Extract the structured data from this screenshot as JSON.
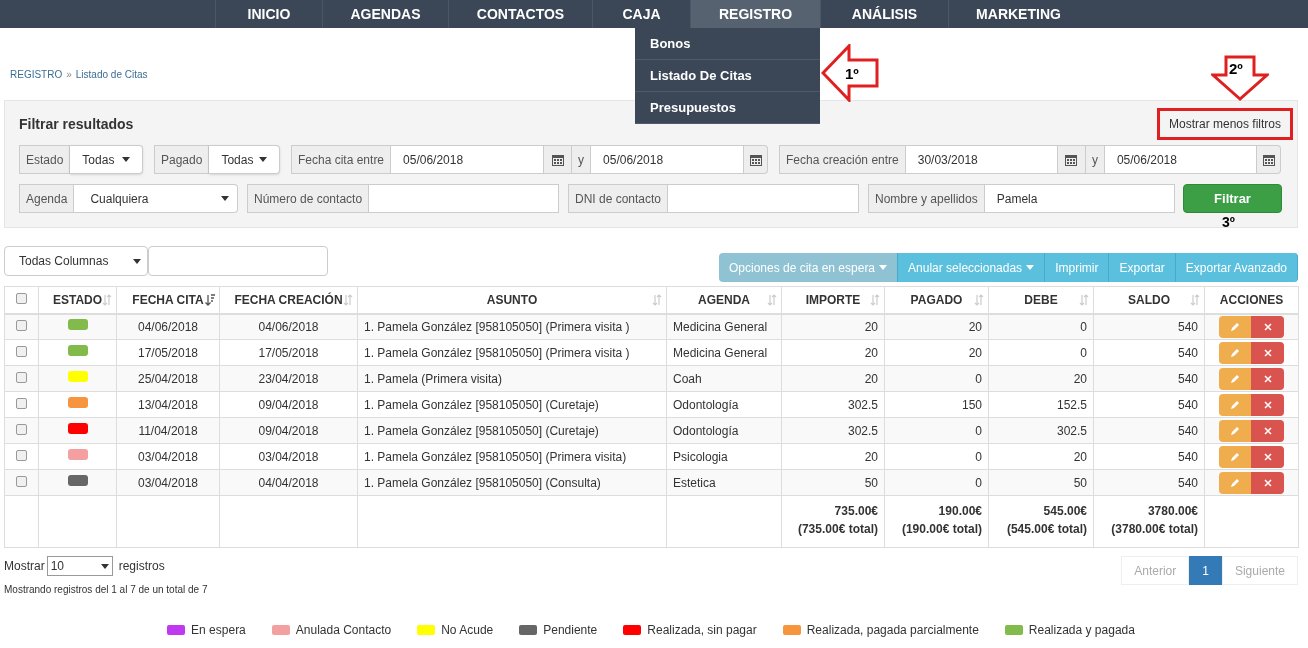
{
  "nav": {
    "items": [
      {
        "label": "INICIO",
        "selected": false
      },
      {
        "label": "AGENDAS",
        "selected": false
      },
      {
        "label": "CONTACTOS",
        "selected": false
      },
      {
        "label": "CAJA",
        "selected": false
      },
      {
        "label": "REGISTRO",
        "selected": true
      },
      {
        "label": "ANÁLISIS",
        "selected": false
      },
      {
        "label": "MARKETING",
        "selected": false
      }
    ],
    "dropdown": [
      "Bonos",
      "Listado De Citas",
      "Presupuestos"
    ]
  },
  "annotations": {
    "arrow_1": "1º",
    "arrow_2": "2º",
    "step_3": "3º"
  },
  "breadcrumb": {
    "items": [
      "REGISTRO",
      "Listado de Citas"
    ],
    "separator": "»"
  },
  "filters": {
    "title": "Filtrar resultados",
    "toggle": {
      "label": "Mostrar menos filtros",
      "highlighted": true
    },
    "row_1": [
      {
        "kind": "select",
        "label": "Estado",
        "value": "Todas"
      },
      {
        "kind": "select",
        "label": "Pagado",
        "value": "Todas"
      },
      {
        "kind": "daterange",
        "label": "Fecha cita entre",
        "from": "05/06/2018",
        "separator": "y",
        "to": "05/06/2018"
      },
      {
        "kind": "daterange",
        "label": "Fecha creación entre",
        "from": "30/03/2018",
        "separator": "y",
        "to": "05/06/2018"
      }
    ],
    "row_2": [
      {
        "kind": "wideselect",
        "label": "Agenda",
        "value": "Cualquiera"
      },
      {
        "kind": "text",
        "label": "Número de contacto"
      },
      {
        "kind": "text",
        "label": "DNI de contacto"
      },
      {
        "kind": "text",
        "label": "Nombre y apellidos",
        "value": "Pamela"
      }
    ],
    "submit": "Filtrar"
  },
  "toolbar": {
    "column_select": "Todas Columnas",
    "buttons": [
      {
        "label": "Opciones de cita en espera",
        "disabled": true,
        "caret": true
      },
      {
        "label": "Anular seleccionadas",
        "disabled": false,
        "caret": true
      },
      {
        "label": "Imprimir",
        "disabled": false,
        "caret": false
      },
      {
        "label": "Exportar",
        "disabled": false,
        "caret": false
      },
      {
        "label": "Exportar Avanzado",
        "disabled": false,
        "caret": false
      }
    ]
  },
  "table": {
    "columns": [
      {
        "kind": "checkbox",
        "checked": false
      },
      {
        "kind": "text",
        "label": "ESTADO",
        "sortable": true,
        "sorted": false
      },
      {
        "kind": "text",
        "label": "FECHA CITA",
        "sortable": true,
        "sorted": true
      },
      {
        "kind": "text",
        "label": "FECHA CREACIÓN",
        "sortable": true,
        "sorted": false
      },
      {
        "kind": "text",
        "label": "ASUNTO",
        "sortable": true,
        "sorted": false
      },
      {
        "kind": "text",
        "label": "AGENDA",
        "sortable": true,
        "sorted": false
      },
      {
        "kind": "text",
        "label": "IMPORTE",
        "sortable": true,
        "sorted": false
      },
      {
        "kind": "text",
        "label": "PAGADO",
        "sortable": true,
        "sorted": false
      },
      {
        "kind": "text",
        "label": "DEBE",
        "sortable": true,
        "sorted": false
      },
      {
        "kind": "text",
        "label": "SALDO",
        "sortable": true,
        "sorted": false
      },
      {
        "kind": "text",
        "label": "ACCIONES",
        "sortable": false
      }
    ],
    "rows": [
      {
        "checked": false,
        "color": "#82bb4b",
        "fecha_cita": "04/06/2018",
        "fecha_creacion": "04/06/2018",
        "asunto": "1. Pamela González [958105050] (Primera visita )",
        "agenda": "Medicina General",
        "importe": "20",
        "pagado": "20",
        "debe": "0",
        "saldo": "540"
      },
      {
        "checked": false,
        "color": "#82bb4b",
        "fecha_cita": "17/05/2018",
        "fecha_creacion": "17/05/2018",
        "asunto": "1. Pamela González [958105050] (Primera visita )",
        "agenda": "Medicina General",
        "importe": "20",
        "pagado": "20",
        "debe": "0",
        "saldo": "540"
      },
      {
        "checked": false,
        "color": "#ffff00",
        "fecha_cita": "25/04/2018",
        "fecha_creacion": "23/04/2018",
        "asunto": "1. Pamela (Primera visita)",
        "agenda": "Coah",
        "importe": "20",
        "pagado": "0",
        "debe": "20",
        "saldo": "540"
      },
      {
        "checked": false,
        "color": "#f7953f",
        "fecha_cita": "13/04/2018",
        "fecha_creacion": "09/04/2018",
        "asunto": "1. Pamela González [958105050] (Curetaje)",
        "agenda": "Odontología",
        "importe": "302.5",
        "pagado": "150",
        "debe": "152.5",
        "saldo": "540"
      },
      {
        "checked": false,
        "color": "#ff0000",
        "fecha_cita": "11/04/2018",
        "fecha_creacion": "09/04/2018",
        "asunto": "1. Pamela González [958105050] (Curetaje)",
        "agenda": "Odontología",
        "importe": "302.5",
        "pagado": "0",
        "debe": "302.5",
        "saldo": "540"
      },
      {
        "checked": false,
        "color": "#f4a0a0",
        "fecha_cita": "03/04/2018",
        "fecha_creacion": "03/04/2018",
        "asunto": "1. Pamela González [958105050] (Primera visita)",
        "agenda": "Psicologia",
        "importe": "20",
        "pagado": "0",
        "debe": "20",
        "saldo": "540"
      },
      {
        "checked": false,
        "color": "#666666",
        "fecha_cita": "03/04/2018",
        "fecha_creacion": "04/04/2018",
        "asunto": "1. Pamela González [958105050] (Consulta)",
        "agenda": "Estetica",
        "importe": "50",
        "pagado": "0",
        "debe": "50",
        "saldo": "540"
      }
    ],
    "totals": [
      {
        "amount": "735.00€",
        "total": "(735.00€ total)"
      },
      {
        "amount": "190.00€",
        "total": "(190.00€ total)"
      },
      {
        "amount": "545.00€",
        "total": "(545.00€ total)"
      },
      {
        "amount": "3780.00€",
        "total": "(3780.00€ total)"
      }
    ]
  },
  "length": {
    "before": "Mostrar",
    "value": "10",
    "after": "registros"
  },
  "info": "Mostrando registros del 1 al 7 de un total de 7",
  "pagination": [
    {
      "label": "Anterior",
      "disabled": true,
      "selected": false
    },
    {
      "label": "1",
      "disabled": false,
      "selected": true
    },
    {
      "label": "Siguiente",
      "disabled": true,
      "selected": false
    }
  ],
  "legend": [
    {
      "label": "En espera",
      "color": "#c038f0"
    },
    {
      "label": "Anulada Contacto",
      "color": "#f4a0a0"
    },
    {
      "label": "No Acude",
      "color": "#ffff00"
    },
    {
      "label": "Pendiente",
      "color": "#666666"
    },
    {
      "label": "Realizada, sin pagar",
      "color": "#ff0000"
    },
    {
      "label": "Realizada, pagada parcialmente",
      "color": "#f7953f"
    },
    {
      "label": "Realizada y pagada",
      "color": "#82bb4b"
    }
  ]
}
